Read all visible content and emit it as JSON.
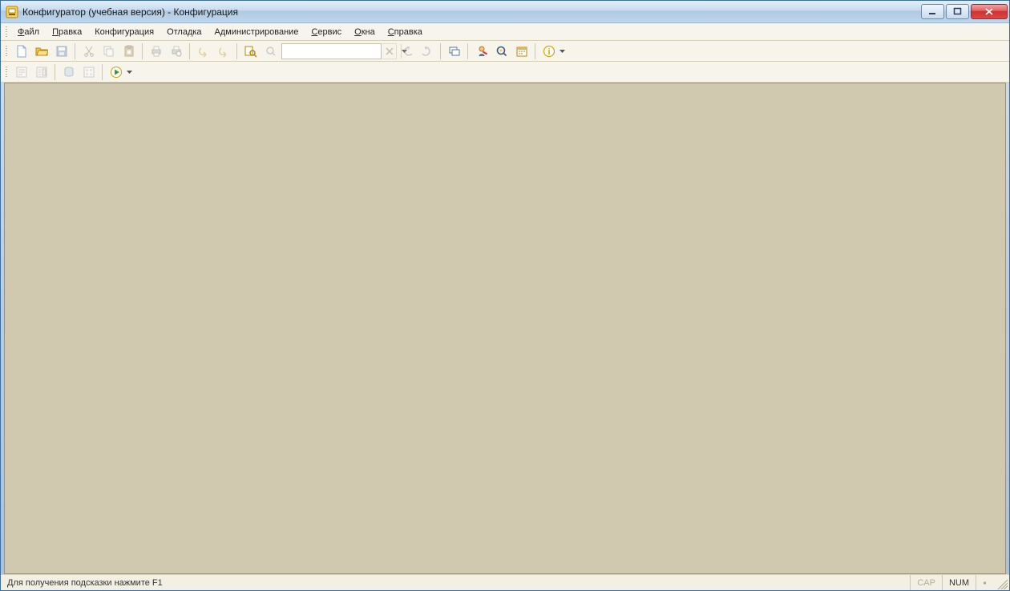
{
  "title": "Конфигуратор (учебная версия) - Конфигурация",
  "menu": {
    "file": "Файл",
    "edit": "Правка",
    "config": "Конфигурация",
    "debug": "Отладка",
    "admin": "Администрирование",
    "service": "Сервис",
    "windows": "Окна",
    "help": "Справка"
  },
  "search": {
    "value": "",
    "placeholder": ""
  },
  "status": {
    "hint": "Для получения подсказки нажмите F1",
    "cap": "CAP",
    "num": "NUM"
  }
}
